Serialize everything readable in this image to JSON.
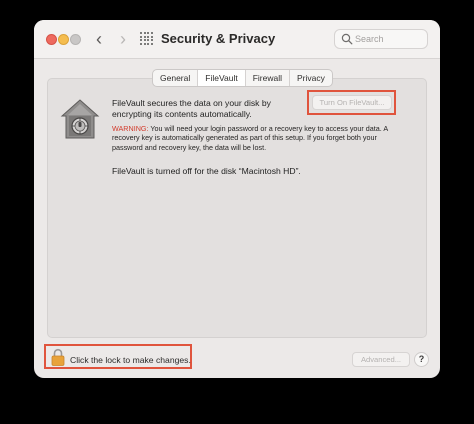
{
  "window": {
    "title": "Security & Privacy",
    "search_placeholder": "Search"
  },
  "icons": {
    "back": "‹",
    "forward": "›",
    "help": "?"
  },
  "tabs": [
    {
      "label": "General",
      "active": false
    },
    {
      "label": "FileVault",
      "active": true
    },
    {
      "label": "Firewall",
      "active": false
    },
    {
      "label": "Privacy",
      "active": false
    }
  ],
  "filevault": {
    "description": "FileVault secures the data on your disk by encrypting its contents automatically.",
    "turn_on_button": "Turn On FileVault...",
    "warning_label": "WARNING:",
    "warning_text": " You will need your login password or a recovery key to access your data. A recovery key is automatically generated as part of this setup. If you forget both your password and recovery key, the data will be lost.",
    "status": "FileVault is turned off for the disk “Macintosh HD”."
  },
  "footer": {
    "lock_text": "Click the lock to make changes.",
    "advanced_button": "Advanced..."
  },
  "colors": {
    "highlight_border": "#e0543d",
    "warning_red": "#d23a2b",
    "close": "#ee6a5f",
    "minimize": "#f5bd4f",
    "zoom": "#c9c7c6",
    "lock": "#e8a23a"
  }
}
